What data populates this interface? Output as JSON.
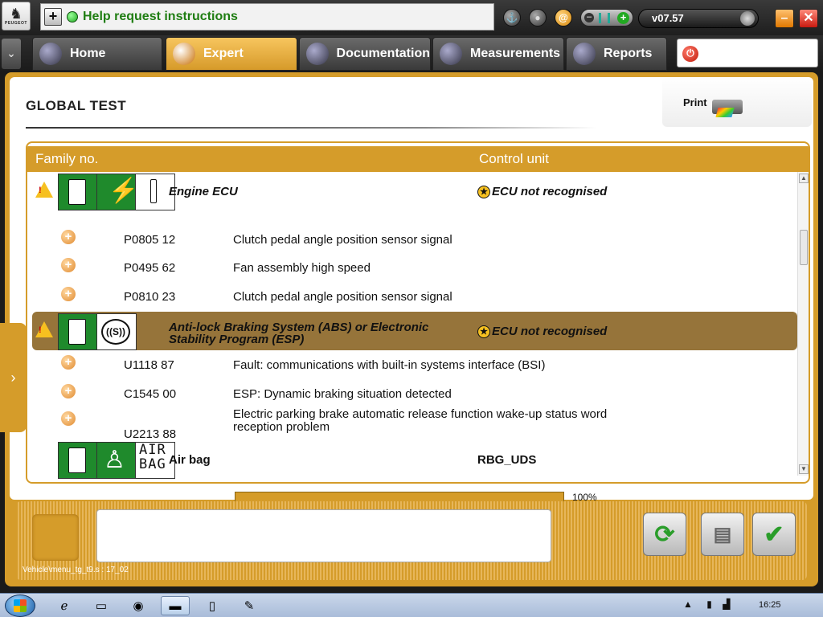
{
  "window": {
    "logo_text": "PEUGEOT",
    "help_text": "Help request instructions",
    "version": "v07.57",
    "icons": [
      "anchor-icon",
      "user-icon",
      "at-icon",
      "toggle-icon"
    ]
  },
  "nav": {
    "tabs": [
      {
        "label": "Home",
        "icon": "home-icon",
        "active": false
      },
      {
        "label": "Expert",
        "icon": "magnifier-icon",
        "active": true
      },
      {
        "label": "Documentation",
        "icon": "book-icon",
        "active": false
      },
      {
        "label": "Measurements",
        "icon": "waveform-icon",
        "active": false
      },
      {
        "label": "Reports",
        "icon": "report-icon",
        "active": false
      }
    ]
  },
  "page": {
    "title": "GLOBAL TEST",
    "print_label": "Print"
  },
  "table": {
    "col_family": "Family no.",
    "col_control": "Control unit",
    "ecus": [
      {
        "name": "Engine ECU",
        "status": "ECU not recognised",
        "faults": [
          {
            "code": "P0805 12",
            "desc": "Clutch pedal angle position sensor signal"
          },
          {
            "code": "P0495 62",
            "desc": "Fan assembly high speed"
          },
          {
            "code": "P0810 23",
            "desc": "Clutch pedal angle position sensor signal"
          }
        ]
      },
      {
        "name_line1": "Anti-lock Braking System (ABS) or Electronic",
        "name_line2": "Stability Program (ESP)",
        "status": "ECU not recognised",
        "faults": [
          {
            "code": "U1118 87",
            "desc": "Fault: communications with built-in systems interface (BSI)"
          },
          {
            "code": "C1545 00",
            "desc": "ESP: Dynamic braking situation detected"
          },
          {
            "code": "U2213 88",
            "desc_line1": "Electric parking brake automatic release function wake-up status word",
            "desc_line2": "reception problem"
          }
        ]
      },
      {
        "name": "Air bag",
        "status": "RBG_UDS",
        "icon_text_line1": "AIR",
        "icon_text_line2": "BAG"
      }
    ]
  },
  "progress": {
    "value": 100,
    "label": "100%"
  },
  "footer": {
    "path": "Vehicle\\menu_tg_t9.s : 17_02"
  },
  "taskbar": {
    "clock": "16:25"
  },
  "colors": {
    "accent": "#d59c2a",
    "selected_row": "#96743a",
    "ecu_green": "#1f8a2c"
  }
}
